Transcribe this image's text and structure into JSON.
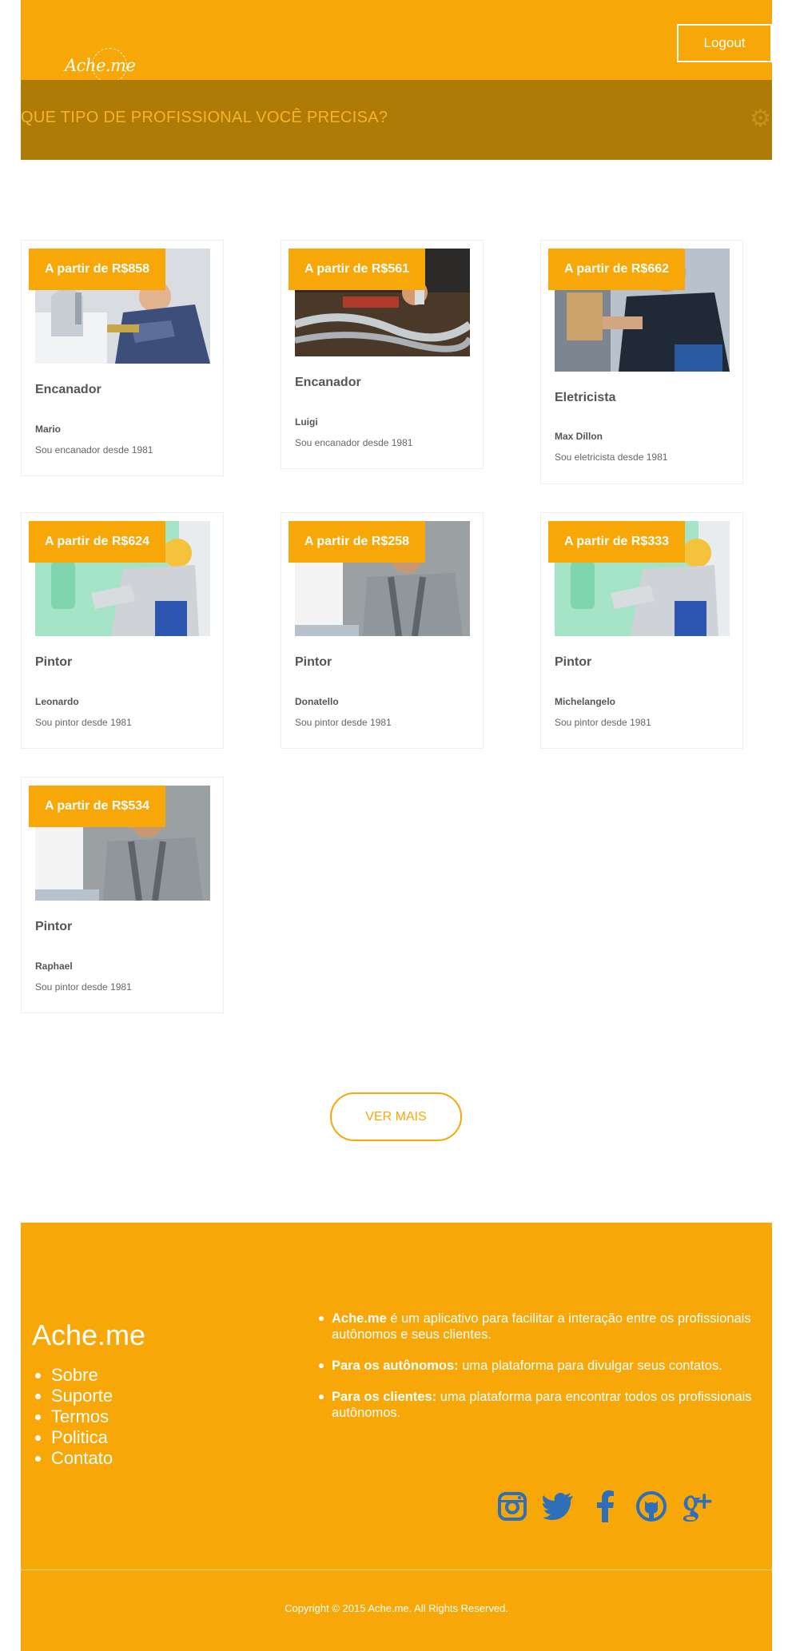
{
  "header": {
    "logo_text": "Ache.me",
    "logout_label": "Logout",
    "search_prompt": "QUE TIPO DE PROFISSIONAL VOCÊ PRECISA?"
  },
  "cards": [
    {
      "price": "A partir de R$858",
      "title": "Encanador",
      "name": "Mario",
      "desc": "Sou encanador desde 1981",
      "image": "plumber-photo"
    },
    {
      "price": "A partir de R$561",
      "title": "Encanador",
      "name": "Luigi",
      "desc": "Sou encanador desde 1981",
      "image": "pipes-photo"
    },
    {
      "price": "A partir de R$662",
      "title": "Eletricista",
      "name": "Max Dillon",
      "desc": "Sou eletricista desde 1981",
      "image": "electrician-photo"
    },
    {
      "price": "A partir de R$624",
      "title": "Pintor",
      "name": "Leonardo",
      "desc": "Sou pintor desde 1981",
      "image": "painter-roller-photo"
    },
    {
      "price": "A partir de R$258",
      "title": "Pintor",
      "name": "Donatello",
      "desc": "Sou pintor desde 1981",
      "image": "painter-wall-photo"
    },
    {
      "price": "A partir de R$333",
      "title": "Pintor",
      "name": "Michelangelo",
      "desc": "Sou pintor desde 1981",
      "image": "painter-roller-photo"
    },
    {
      "price": "A partir de R$534",
      "title": "Pintor",
      "name": "Raphael",
      "desc": "Sou pintor desde 1981",
      "image": "painter-wall-photo"
    }
  ],
  "ver_mais_label": "VER MAIS",
  "footer": {
    "brand": "Ache.me",
    "links": [
      "Sobre",
      "Suporte",
      "Termos",
      "Politica",
      "Contato"
    ],
    "about": [
      {
        "bold": "Ache.me",
        "text": " é um aplicativo para facilitar a interação entre os profissionais autônomos e seus clientes."
      },
      {
        "bold": "Para os autônomos:",
        "text": " uma plataforma para divulgar seus contatos."
      },
      {
        "bold": "Para os clientes:",
        "text": " uma plataforma para encontrar todos os profissionais autônomos."
      }
    ],
    "social_icons": [
      "instagram-icon",
      "twitter-icon",
      "facebook-icon",
      "github-icon",
      "google-plus-icon"
    ],
    "copyright": "Copyright © 2015 Ache.me. All Rights Reserved."
  },
  "colors": {
    "brand": "#f7a808",
    "search_bar": "#ae7b06",
    "social_icon": "#2f6fb8"
  }
}
